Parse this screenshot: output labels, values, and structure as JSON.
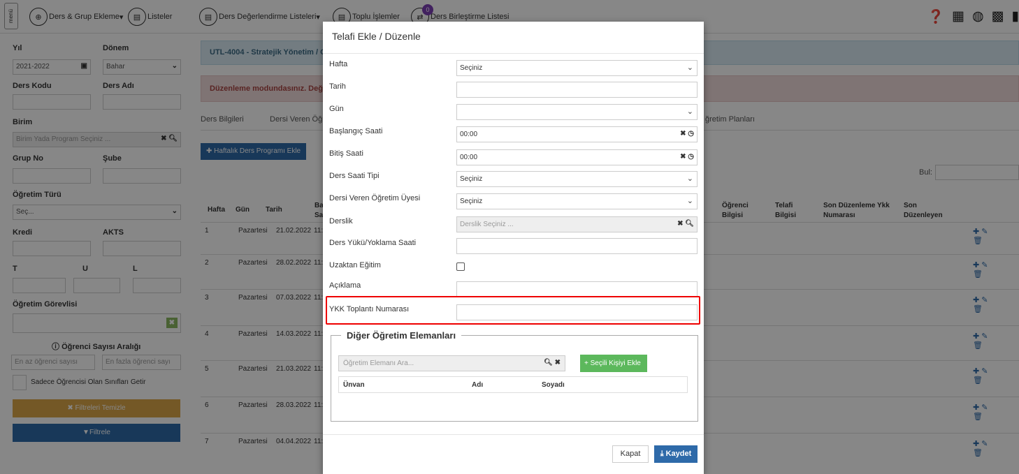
{
  "topnav": {
    "menu": "menü",
    "items": [
      {
        "label": "Ders & Grup Ekleme",
        "icon": "plus-icon"
      },
      {
        "label": "Listeler",
        "icon": "document-icon"
      },
      {
        "label": "Ders Değerlendirme Listeleri",
        "icon": "document-icon"
      },
      {
        "label": "Toplu İşlemler",
        "icon": "document-icon"
      },
      {
        "label": "Ders Birleştirme Listesi",
        "icon": "shuffle-icon",
        "badge": "0"
      }
    ]
  },
  "sidebar": {
    "yil_label": "Yıl",
    "yil_value": "2021-2022",
    "donem_label": "Dönem",
    "donem_value": "Bahar",
    "ders_kodu_label": "Ders Kodu",
    "ders_adi_label": "Ders Adı",
    "birim_label": "Birim",
    "birim_placeholder": "Birim Yada Program Seçiniz ...",
    "grup_label": "Grup No",
    "sube_label": "Şube",
    "ogretim_turu_label": "Öğretim Türü",
    "ogretim_turu_value": "Seç...",
    "kredi_label": "Kredi",
    "akts_label": "AKTS",
    "t_label": "T",
    "u_label": "U",
    "l_label": "L",
    "gorevlisi_label": "Öğretim Görevlisi",
    "sayi_label": "Öğrenci Sayısı Aralığı",
    "min_placeholder": "En az öğrenci sayısı",
    "max_placeholder": "En fazla öğrenci sayı",
    "only_label": "Sadece Öğrencisi Olan Sınıfları Getir",
    "clear_btn": "✖ Filtreleri Temizle",
    "filter_btn": "Filtrele"
  },
  "main": {
    "title": "UTL-4004 - Stratejik Yönetim / C",
    "warning": "Düzenleme modundasınız. Değ",
    "tabs": [
      "Ders Bilgileri",
      "Dersi Veren Öğ",
      "ğretim Planları"
    ],
    "add_btn": "Haftalık Ders Programı Ekle",
    "search_label": "Bul:",
    "headers": {
      "hafta": "Hafta",
      "gun": "Gün",
      "tarih": "Tarih",
      "basla": "Ba Sa",
      "ogrenci": "Öğrenci Bilgisi",
      "telafi": "Telafi Bilgisi",
      "sonduz": "Son Düzenleme Ykk Numarası",
      "sondu2": "Son Düzenleyen"
    },
    "rows": [
      {
        "hafta": "1",
        "gun": "Pazartesi",
        "tarih": "21.02.2022",
        "saat": "11:"
      },
      {
        "hafta": "2",
        "gun": "Pazartesi",
        "tarih": "28.02.2022",
        "saat": "11:"
      },
      {
        "hafta": "3",
        "gun": "Pazartesi",
        "tarih": "07.03.2022",
        "saat": "11:"
      },
      {
        "hafta": "4",
        "gun": "Pazartesi",
        "tarih": "14.03.2022",
        "saat": "11:"
      },
      {
        "hafta": "5",
        "gun": "Pazartesi",
        "tarih": "21.03.2022",
        "saat": "11:"
      },
      {
        "hafta": "6",
        "gun": "Pazartesi",
        "tarih": "28.03.2022",
        "saat": "11:"
      },
      {
        "hafta": "7",
        "gun": "Pazartesi",
        "tarih": "04.04.2022",
        "saat": "11:"
      }
    ]
  },
  "modal": {
    "title": "Telafi Ekle / Düzenle",
    "fields": {
      "hafta": "Hafta",
      "hafta_value": "Seçiniz",
      "tarih": "Tarih",
      "gun": "Gün",
      "baslangic": "Başlangıç Saati",
      "baslangic_value": "00:00",
      "bitis": "Bitiş Saati",
      "bitis_value": "00:00",
      "tip": "Ders Saati Tipi",
      "tip_value": "Seçiniz",
      "uye": "Dersi Veren Öğretim Üyesi",
      "uye_value": "Seçiniz",
      "derslik": "Derslik",
      "derslik_placeholder": "Derslik Seçiniz ...",
      "yuk": "Ders Yükü/Yoklama Saati",
      "uzaktan": "Uzaktan Eğitim",
      "aciklama": "Açıklama",
      "ykk": "YKK Toplantı Numarası"
    },
    "others": {
      "legend": "Diğer Öğretim Elemanları",
      "search_placeholder": "Öğretim Elemanı Ara...",
      "add_btn": "+ Seçili Kişiyi Ekle",
      "col_unvan": "Ünvan",
      "col_adi": "Adı",
      "col_soyadi": "Soyadı"
    },
    "close_btn": "Kapat",
    "save_btn": "Kaydet"
  }
}
